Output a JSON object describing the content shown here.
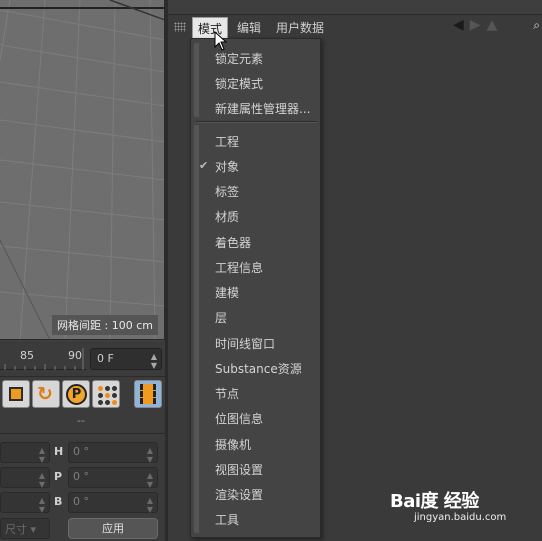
{
  "viewport": {
    "grid_spacing_label": "网格间距 : 100 cm"
  },
  "timeline": {
    "ticks": [
      "85",
      "90"
    ],
    "current_frame": "0 F"
  },
  "attributes": {
    "header": "--",
    "rows": [
      {
        "axis": "H",
        "value": "0 °"
      },
      {
        "axis": "P",
        "value": "0 °"
      },
      {
        "axis": "B",
        "value": "0 °"
      }
    ],
    "size_select": "尺寸",
    "apply_label": "应用"
  },
  "menubar": {
    "mode": "模式",
    "edit": "编辑",
    "user_data": "用户数据"
  },
  "dropdown": {
    "group1": [
      "锁定元素",
      "锁定模式",
      "新建属性管理器..."
    ],
    "group2": [
      "工程",
      "对象",
      "标签",
      "材质",
      "着色器",
      "工程信息",
      "建模",
      "层",
      "时间线窗口",
      "Substance资源",
      "节点",
      "位图信息",
      "摄像机",
      "视图设置",
      "渲染设置",
      "工具"
    ],
    "checked_index": 1
  },
  "watermark": {
    "logo": "Bai度 经验",
    "url": "jingyan.baidu.com"
  },
  "colors": {
    "accent_orange": "#f09a1e",
    "menu_bg": "#444444",
    "panel_bg": "#3a3a3a"
  }
}
